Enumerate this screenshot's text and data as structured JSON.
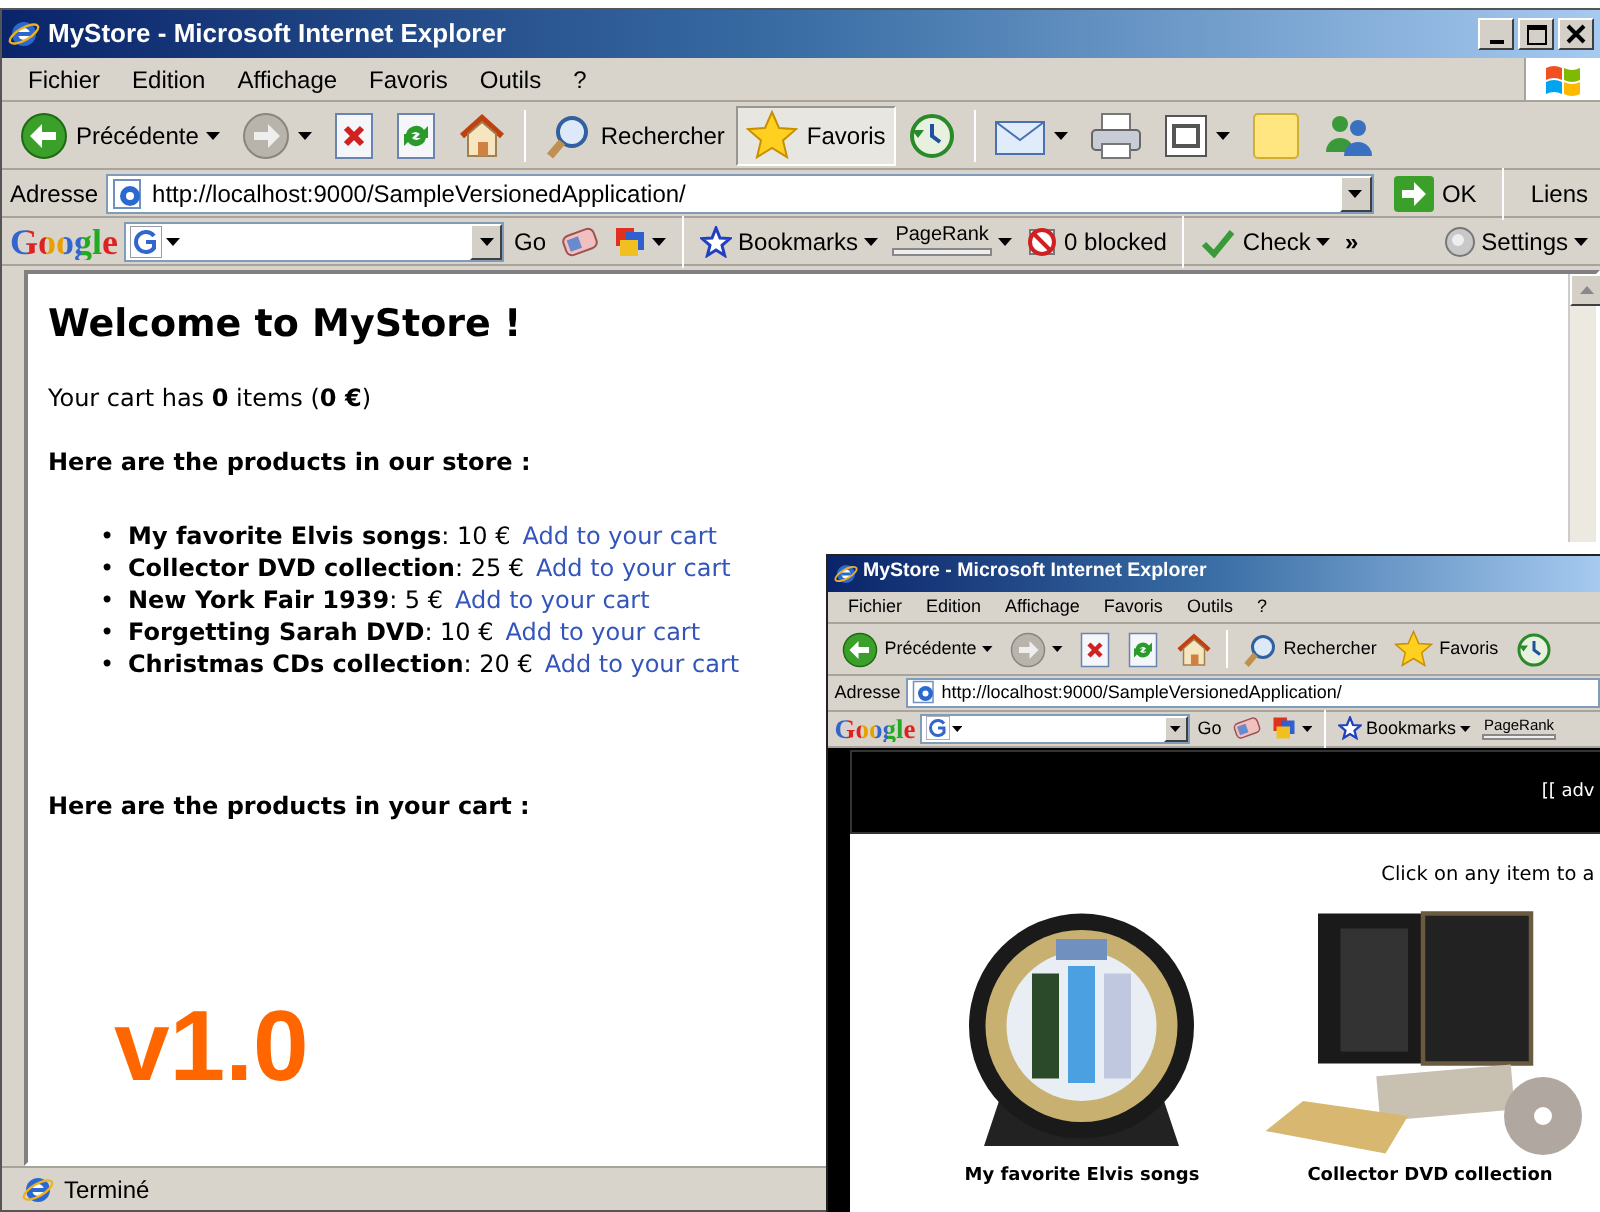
{
  "main_window": {
    "title": "MyStore - Microsoft Internet Explorer",
    "window_buttons": [
      {
        "kind": "minimize"
      },
      {
        "kind": "maximize"
      },
      {
        "kind": "close"
      }
    ],
    "menu": [
      "Fichier",
      "Edition",
      "Affichage",
      "Favoris",
      "Outils",
      "?"
    ],
    "toolbar": [
      {
        "kind": "back",
        "label": "Précédente",
        "dropdown": true,
        "pressed": false
      },
      {
        "kind": "forward",
        "dropdown": true,
        "pressed": false
      },
      {
        "kind": "stop",
        "dropdown": false,
        "pressed": false
      },
      {
        "kind": "refresh",
        "dropdown": false,
        "pressed": false
      },
      {
        "kind": "home",
        "dropdown": false,
        "pressed": false
      },
      {
        "kind": "separator"
      },
      {
        "kind": "search",
        "label": "Rechercher",
        "dropdown": false,
        "pressed": false
      },
      {
        "kind": "favorites",
        "label": "Favoris",
        "dropdown": false,
        "pressed": true
      },
      {
        "kind": "history",
        "dropdown": false,
        "pressed": false
      },
      {
        "kind": "separator"
      },
      {
        "kind": "mail",
        "dropdown": true,
        "pressed": false
      },
      {
        "kind": "print",
        "dropdown": false,
        "pressed": false
      },
      {
        "kind": "edit",
        "dropdown": true,
        "pressed": false
      },
      {
        "kind": "note",
        "dropdown": false,
        "pressed": false
      },
      {
        "kind": "messenger",
        "dropdown": false,
        "pressed": false
      }
    ],
    "address": {
      "label": "Adresse",
      "url": "http://localhost:9000/SampleVersionedApplication/",
      "go": "OK",
      "links": "Liens"
    },
    "google_bar": [
      {
        "kind": "logo",
        "label": "Google"
      },
      {
        "kind": "search",
        "dropdown": true
      },
      {
        "kind": "go",
        "label": "Go",
        "dropdown": false
      },
      {
        "kind": "popup",
        "dropdown": false
      },
      {
        "kind": "highlight",
        "dropdown": true
      },
      {
        "kind": "separator"
      },
      {
        "kind": "bookmarks",
        "label": "Bookmarks",
        "dropdown": true
      },
      {
        "kind": "pagerank",
        "label": "PageRank",
        "dropdown": true
      },
      {
        "kind": "blocked",
        "label": "0 blocked",
        "dropdown": false
      },
      {
        "kind": "separator"
      },
      {
        "kind": "check",
        "label": "Check",
        "dropdown": true
      },
      {
        "kind": "more",
        "label": "»",
        "dropdown": false
      },
      {
        "kind": "settings",
        "label": "Settings",
        "dropdown": true
      }
    ],
    "page": {
      "heading": "Welcome to MyStore !",
      "cart_summary": "Your cart has **0** items (**0 €**)",
      "store_heading": "Here are the products in our store :",
      "products": [
        {
          "bullet": "•",
          "name": "My favorite Elvis songs",
          "price": ": 10 €",
          "link": "Add to your cart"
        },
        {
          "bullet": "•",
          "name": "Collector DVD collection",
          "price": ": 25 €",
          "link": "Add to your cart"
        },
        {
          "bullet": "•",
          "name": "New York Fair 1939",
          "price": ": 5 €",
          "link": "Add to your cart"
        },
        {
          "bullet": "•",
          "name": "Forgetting Sarah DVD",
          "price": ": 10 €",
          "link": "Add to your cart"
        },
        {
          "bullet": "•",
          "name": "Christmas CDs collection",
          "price": ": 20 €",
          "link": "Add to your cart"
        }
      ],
      "cart_heading": "Here are the products in your cart :"
    },
    "version": "v1.0",
    "status": "Terminé"
  },
  "second_window": {
    "title": "MyStore - Microsoft Internet Explorer",
    "menu": [
      "Fichier",
      "Edition",
      "Affichage",
      "Favoris",
      "Outils",
      "?"
    ],
    "toolbar": [
      {
        "kind": "back",
        "label": "Précédente",
        "dropdown": true,
        "pressed": false
      },
      {
        "kind": "forward",
        "dropdown": true,
        "pressed": false
      },
      {
        "kind": "stop",
        "dropdown": false,
        "pressed": false
      },
      {
        "kind": "refresh",
        "dropdown": false,
        "pressed": false
      },
      {
        "kind": "home",
        "dropdown": false,
        "pressed": false
      },
      {
        "kind": "separator"
      },
      {
        "kind": "search",
        "label": "Rechercher",
        "dropdown": false,
        "pressed": false
      },
      {
        "kind": "favorites",
        "label": "Favoris",
        "dropdown": false,
        "pressed": false
      },
      {
        "kind": "history",
        "dropdown": false,
        "pressed": false
      }
    ],
    "address": {
      "label": "Adresse",
      "url": "http://localhost:9000/SampleVersionedApplication/"
    },
    "google_bar": [
      {
        "kind": "logo",
        "label": "Google"
      },
      {
        "kind": "search",
        "dropdown": true
      },
      {
        "kind": "go",
        "label": "Go",
        "dropdown": false
      },
      {
        "kind": "popup",
        "dropdown": false
      },
      {
        "kind": "highlight",
        "dropdown": true
      },
      {
        "kind": "separator"
      },
      {
        "kind": "bookmarks",
        "label": "Bookmarks",
        "dropdown": true
      },
      {
        "kind": "pagerank",
        "label": "PageRank",
        "dropdown": false
      }
    ],
    "page": {
      "banner": "[[ adv",
      "prompt": "Click on any item to a",
      "items": [
        {
          "kind": "picture",
          "caption": "My favorite Elvis songs"
        },
        {
          "kind": "picture",
          "caption": "Collector DVD collection"
        }
      ]
    }
  }
}
